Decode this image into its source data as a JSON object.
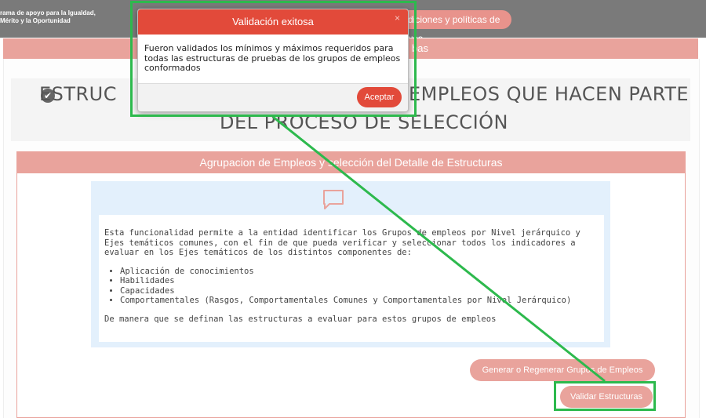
{
  "topbar": {
    "brand_line1": "rama de apoyo para la Igualdad,",
    "brand_line2": "Mérito y la Oportunidad",
    "terms_pill": "diciones y políticas de uso"
  },
  "header_strip": {
    "tail": "bas"
  },
  "page": {
    "title": "ESTRUCTURA DE PRUEBAS DE LOS EMPLEOS QUE HACEN PARTE DEL PROCESO DE SELECCIÓN",
    "title_visible_left": "ESTRUC",
    "title_visible_right": "EMPLEOS QUE HACEN PARTE",
    "title_line2": "DEL PROCESO DE SELECCIÓN"
  },
  "panel": {
    "header": "Agrupacion de Empleos y selección del Detalle de Estructuras",
    "intro": "Esta funcionalidad permite a la entidad identificar los Grupos de empleos por Nivel jerárquico y Ejes temáticos comunes, con el fin de que pueda verificar y seleccionar todos los indicadores a evaluar en los Ejes temáticos de los distintos componentes de:",
    "items": [
      "Aplicación de conocimientos",
      "Habilidades",
      "Capacidades",
      "Comportamentales (Rasgos, Comportamentales Comunes y Comportamentales por Nivel Jerárquico)"
    ],
    "closing": "De manera que se definan las estructuras a evaluar para estos grupos de empleos",
    "icon": "chat-bubble-icon"
  },
  "buttons": {
    "generar": "Generar o Regenerar Grupos de Empleos",
    "validar": "Validar Estructuras"
  },
  "modal": {
    "title": "Validación exitosa",
    "close": "×",
    "message": "Fueron validados los mínimos y máximos requeridos para todas las estructuras de pruebas de los grupos de empleos conformados",
    "accept": "Aceptar"
  },
  "colors": {
    "accent": "#e9a39c",
    "modal_header": "#e24a3a",
    "annotation": "#2db94d"
  }
}
